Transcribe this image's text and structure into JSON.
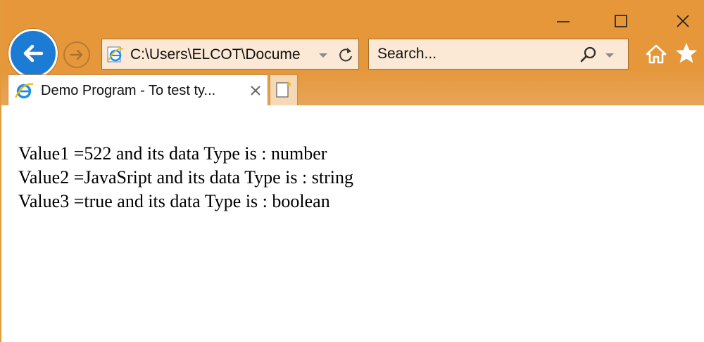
{
  "window": {
    "controls": {
      "minimize_icon": "minimize-icon",
      "maximize_icon": "maximize-icon",
      "close_icon": "close-icon"
    }
  },
  "navigation": {
    "back_icon": "back-arrow-icon",
    "forward_icon": "forward-arrow-icon"
  },
  "address_bar": {
    "value": "C:\\Users\\ELCOT\\Docume",
    "site_icon": "ie-logo-icon",
    "dropdown_icon": "chevron-down-icon",
    "refresh_icon": "refresh-icon"
  },
  "search_bar": {
    "placeholder": "Search...",
    "search_icon": "search-icon",
    "dropdown_icon": "chevron-down-icon"
  },
  "toolbar": {
    "home_icon": "home-icon",
    "favorites_icon": "star-icon"
  },
  "tabs": [
    {
      "title": "Demo Program - To test ty...",
      "icon": "ie-logo-icon",
      "close_icon": "close-icon"
    }
  ],
  "new_tab": {
    "icon": "new-tab-icon"
  },
  "page": {
    "lines": [
      "Value1 =522 and its data Type is : number",
      "Value2 =JavaSript and its data Type is : string",
      "Value3 =true and its data Type is : boolean"
    ]
  },
  "colors": {
    "chrome": "#e6973a",
    "back_button": "#1c7bd4",
    "field_background": "#fbe9d5"
  }
}
